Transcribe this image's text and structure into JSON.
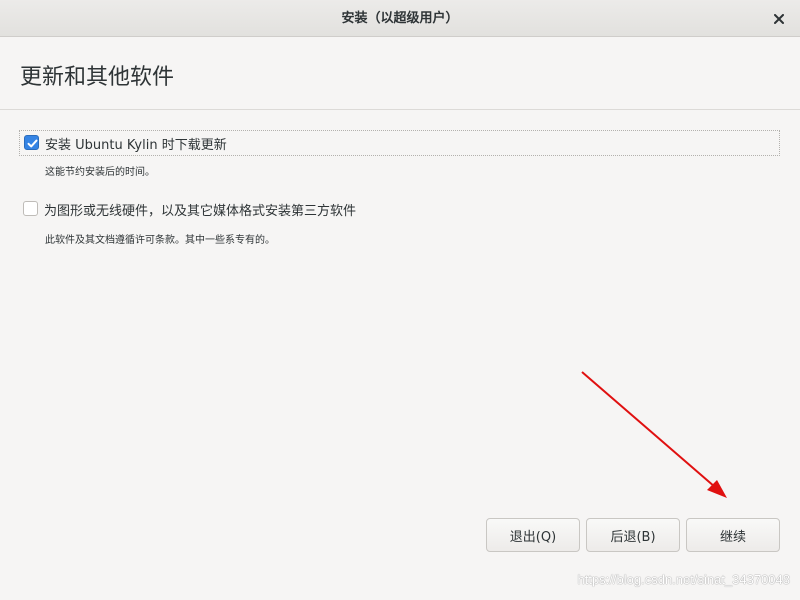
{
  "window": {
    "title": "安装（以超级用户）",
    "close_icon": "close-icon"
  },
  "page": {
    "title": "更新和其他软件"
  },
  "options": [
    {
      "label": "安装 Ubuntu Kylin 时下载更新",
      "description": "这能节约安装后的时间。",
      "checked": true
    },
    {
      "label": "为图形或无线硬件，以及其它媒体格式安装第三方软件",
      "description": "此软件及其文档遵循许可条款。其中一些系专有的。",
      "checked": false
    }
  ],
  "buttons": {
    "quit": "退出(Q)",
    "back": "后退(B)",
    "continue": "继续"
  },
  "colors": {
    "accent": "#3584e4",
    "annotation_arrow": "#e01010"
  },
  "watermark": "https://blog.csdn.net/sinat_34370048"
}
